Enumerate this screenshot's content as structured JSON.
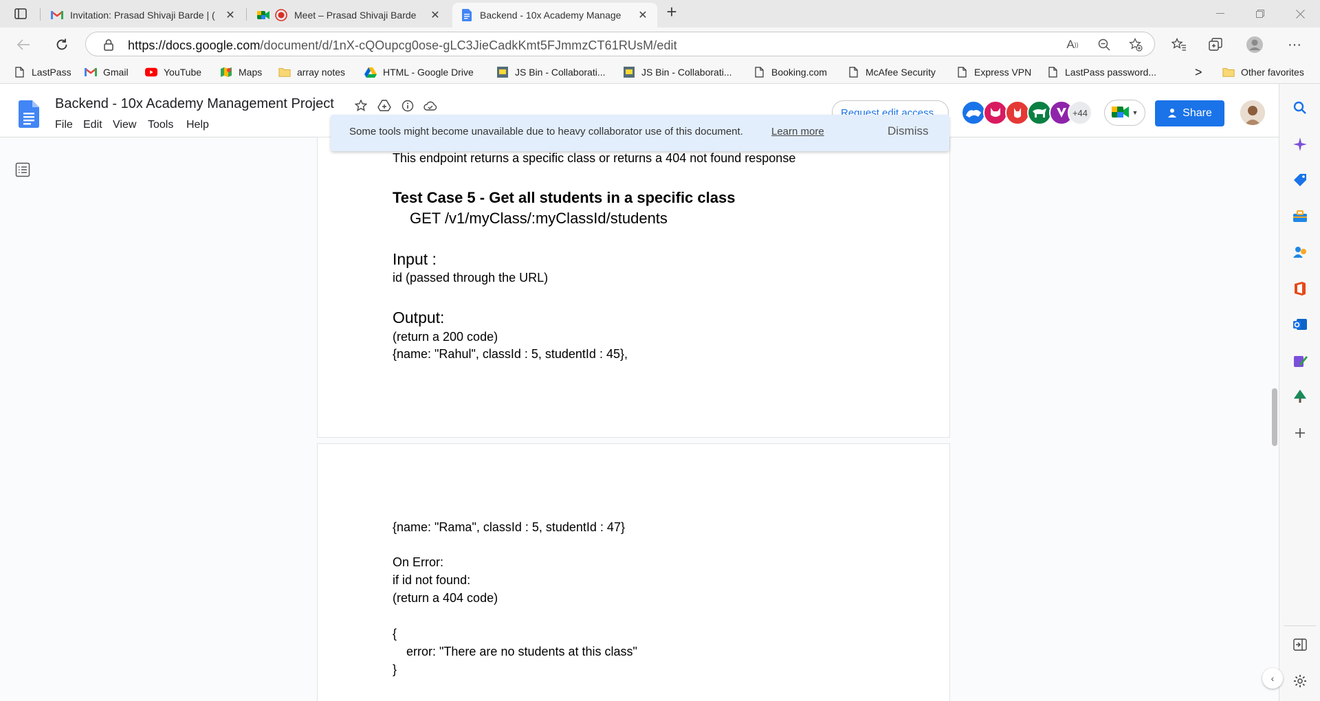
{
  "browser": {
    "tabs": [
      {
        "title": "Invitation: Prasad Shivaji Barde | (",
        "favicon": "gmail-icon"
      },
      {
        "title": "Meet – Prasad Shivaji Barde",
        "favicon": "meet-icon"
      },
      {
        "title": "Backend - 10x Academy Manage",
        "favicon": "docs-icon",
        "active": true
      }
    ],
    "new_tab": "+",
    "url_host": "https://docs.google.com",
    "url_path": "/document/d/1nX-cQOupcg0ose-gLC3JieCadkKmt5FJmmzCT61RUsM/edit",
    "favorites": [
      {
        "label": "LastPass",
        "icon": "page-icon"
      },
      {
        "label": "Gmail",
        "icon": "gmail-icon"
      },
      {
        "label": "YouTube",
        "icon": "youtube-icon"
      },
      {
        "label": "Maps",
        "icon": "maps-icon"
      },
      {
        "label": "array notes",
        "icon": "folder-icon"
      },
      {
        "label": "HTML - Google Drive",
        "icon": "drive-icon"
      },
      {
        "label": "JS Bin - Collaborati...",
        "icon": "jsbin-icon"
      },
      {
        "label": "JS Bin - Collaborati...",
        "icon": "jsbin-icon"
      },
      {
        "label": "Booking.com",
        "icon": "page-icon"
      },
      {
        "label": "McAfee Security",
        "icon": "page-icon"
      },
      {
        "label": "Express VPN",
        "icon": "page-icon"
      },
      {
        "label": "LastPass password...",
        "icon": "page-icon"
      }
    ],
    "more_favorites": ">",
    "other_favorites": "Other favorites"
  },
  "docs": {
    "title": "Backend - 10x Academy Management Project",
    "menu": [
      "File",
      "Edit",
      "View",
      "Tools",
      "Help"
    ],
    "request_edit": "Request edit access",
    "more_collaborators": "+44",
    "share": "Share",
    "notice": {
      "message": "Some tools might become unavailable due to heavy collaborator use of this document.",
      "learn_more": "Learn more",
      "dismiss": "Dismiss"
    }
  },
  "content": {
    "p1_line1": "This endpoint returns a specific class or returns a 404 not found response",
    "tc5_heading": "Test Case 5 - Get all students in a specific class",
    "tc5_endpoint": "GET /v1/myClass/:myClassId/students",
    "input_heading": "Input :",
    "input_text": "id (passed through the URL)",
    "output_heading": "Output:",
    "output_code": "(return a 200 code)",
    "output_line1": "{name: \"Rahul\", classId : 5, studentId : 45},",
    "p2_line1": "{name: \"Rama\", classId : 5, studentId : 47}",
    "on_error": "On Error:",
    "if_not_found": "if id not found:",
    "error_code": "(return a 404 code)",
    "brace_open": "{",
    "error_msg": "    error: \"There are no students at this class\"",
    "brace_close": "}"
  },
  "colors": {
    "docs_blue": "#1a73e8",
    "share_blue": "#1a73e8",
    "notice_bg": "#e3eefc"
  }
}
